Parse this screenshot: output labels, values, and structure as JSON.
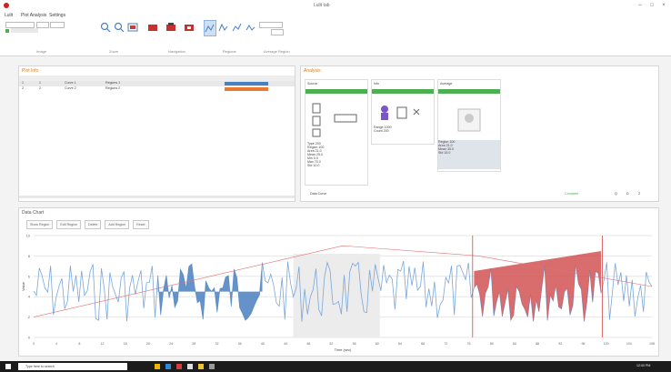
{
  "window": {
    "title": "Lulit tab"
  },
  "menu": [
    "Lulit",
    "Plot Analysis",
    "Settings"
  ],
  "ribbon": {
    "groups": [
      "Image",
      "Zoom",
      "Navigation",
      "Regions",
      "Average Region"
    ],
    "fields": [
      "29",
      "40",
      "29"
    ]
  },
  "panels": {
    "left_title": "Plot Info",
    "right_title": "Analysis",
    "bottom_title": "Data Chart",
    "status_text": "Data Curve",
    "status_badge": "Complete",
    "status_buttons": [
      "Q",
      "D",
      "Z"
    ]
  },
  "table": {
    "columns": [
      "No.",
      "",
      "Name",
      "Name",
      "Tag",
      "Line",
      "Range",
      "Color"
    ],
    "rows": [
      {
        "no": "1",
        "check": "1",
        "name": "Curve 1",
        "name2": "Regions 1",
        "tag": "",
        "line": "",
        "range": ""
      },
      {
        "no": "2",
        "check": "2",
        "name": "Curve 2",
        "name2": "Regions 2",
        "tag": "",
        "line": "",
        "range": ""
      }
    ]
  },
  "cards": [
    {
      "title": "Source",
      "badge": "",
      "rows": [
        [
          "Type",
          "200"
        ],
        [
          "Region",
          "100"
        ],
        [
          "Area",
          "21.0"
        ],
        [
          "Mean",
          "25.0"
        ],
        [
          "Min",
          "0.0"
        ],
        [
          "Max",
          "70.0"
        ],
        [
          "Std",
          "10.0"
        ]
      ]
    },
    {
      "title": "Info",
      "badge": "",
      "rows": [
        [
          "Range",
          "1000"
        ],
        [
          "Count",
          "200"
        ]
      ]
    },
    {
      "title": "Average",
      "badge": "",
      "rows": [
        [
          "Region",
          "100"
        ],
        [
          "Area",
          "21.0"
        ],
        [
          "Mean",
          "35.0"
        ],
        [
          "Std",
          "15.0"
        ]
      ]
    }
  ],
  "chart_toolbar": [
    "Show Region",
    "Edit Region",
    "Delete",
    "Add Region",
    "Reset"
  ],
  "chart_data": {
    "type": "line",
    "xlabel": "Time (sec)",
    "ylabel": "Value",
    "xlim": [
      0,
      110
    ],
    "ylim": [
      0,
      10
    ],
    "series": [
      {
        "name": "",
        "color": "#7aa7d8"
      },
      {
        "name": "",
        "color": "#e07070"
      }
    ],
    "x_ticks": [
      "0",
      "4",
      "8",
      "12",
      "16",
      "20",
      "24",
      "28",
      "32",
      "36",
      "40",
      "44",
      "48",
      "52",
      "56",
      "60",
      "64",
      "68",
      "72",
      "76",
      "80",
      "84",
      "88",
      "92",
      "96",
      "100",
      "104",
      "108"
    ],
    "y_ticks": [
      "0",
      "2",
      "4",
      "6",
      "8",
      "10"
    ]
  },
  "taskbar": {
    "search_placeholder": "Type here to search",
    "clock": "12:00 PM"
  },
  "colors": {
    "accent": "#e07a1a",
    "blue": "#4a7fc0",
    "orange": "#e8792f",
    "green": "#4caf50",
    "red": "#d04848"
  }
}
